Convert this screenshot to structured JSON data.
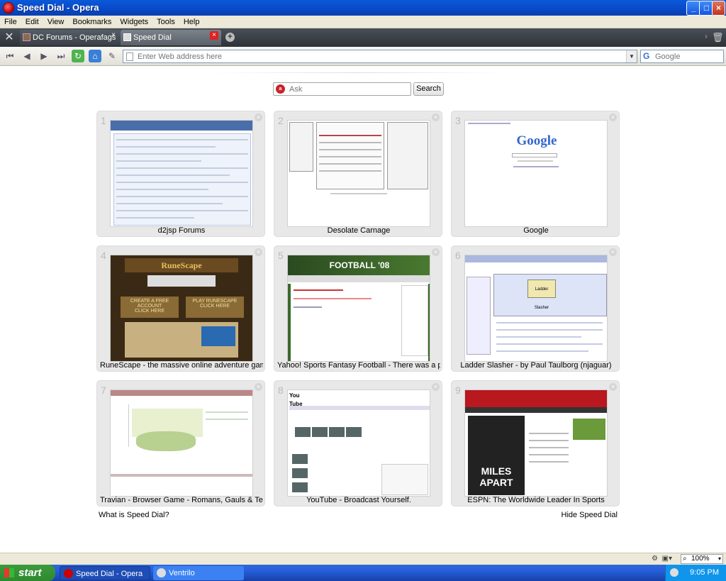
{
  "window": {
    "title": "Speed Dial - Opera"
  },
  "menu": [
    "File",
    "Edit",
    "View",
    "Bookmarks",
    "Widgets",
    "Tools",
    "Help"
  ],
  "tabs": [
    {
      "label": "DC Forums - Operafags",
      "active": false
    },
    {
      "label": "Speed Dial",
      "active": true
    }
  ],
  "address": {
    "placeholder": "Enter Web address here"
  },
  "search_engine": {
    "placeholder": "Google",
    "icon": "google-g-icon"
  },
  "speed_dial": {
    "search_placeholder": "Ask",
    "search_button": "Search",
    "dials": [
      {
        "num": "1",
        "title": "d2jsp Forums"
      },
      {
        "num": "2",
        "title": "Desolate Carnage"
      },
      {
        "num": "3",
        "title": "Google"
      },
      {
        "num": "4",
        "title": "RuneScape - the massive online adventure game ..."
      },
      {
        "num": "5",
        "title": "Yahoo! Sports Fantasy Football - There was a pro..."
      },
      {
        "num": "6",
        "title": "Ladder Slasher - by Paul Taulborg (njaguar)"
      },
      {
        "num": "7",
        "title": "Travian - Browser Game - Romans, Gauls & Teutons"
      },
      {
        "num": "8",
        "title": "YouTube - Broadcast Yourself."
      },
      {
        "num": "9",
        "title": "ESPN: The Worldwide Leader In Sports"
      }
    ],
    "what_is": "What is Speed Dial?",
    "hide": "Hide Speed Dial",
    "thumb_text": {
      "google": "Google",
      "yahoo": "FOOTBALL '08",
      "youtube": "You Tube",
      "espn": "MILES APART",
      "runescape": "RuneScape",
      "runescape_create": "CREATE A FREE ACCOUNT",
      "runescape_play": "PLAY RUNESCAPE",
      "runescape_click": "CLICK HERE",
      "ladder": "Ladder Slasher"
    }
  },
  "status": {
    "zoom": "100%"
  },
  "taskbar": {
    "start": "start",
    "tasks": [
      {
        "label": "Speed Dial - Opera"
      },
      {
        "label": "Ventrilo"
      }
    ],
    "clock": "9:05 PM"
  },
  "colors": {
    "titlebar": "#0a5ad9",
    "tabbar": "#3b4048",
    "dial_bg": "#e8e8e8",
    "taskbar": "#245edb",
    "start": "#3c9a3c"
  }
}
